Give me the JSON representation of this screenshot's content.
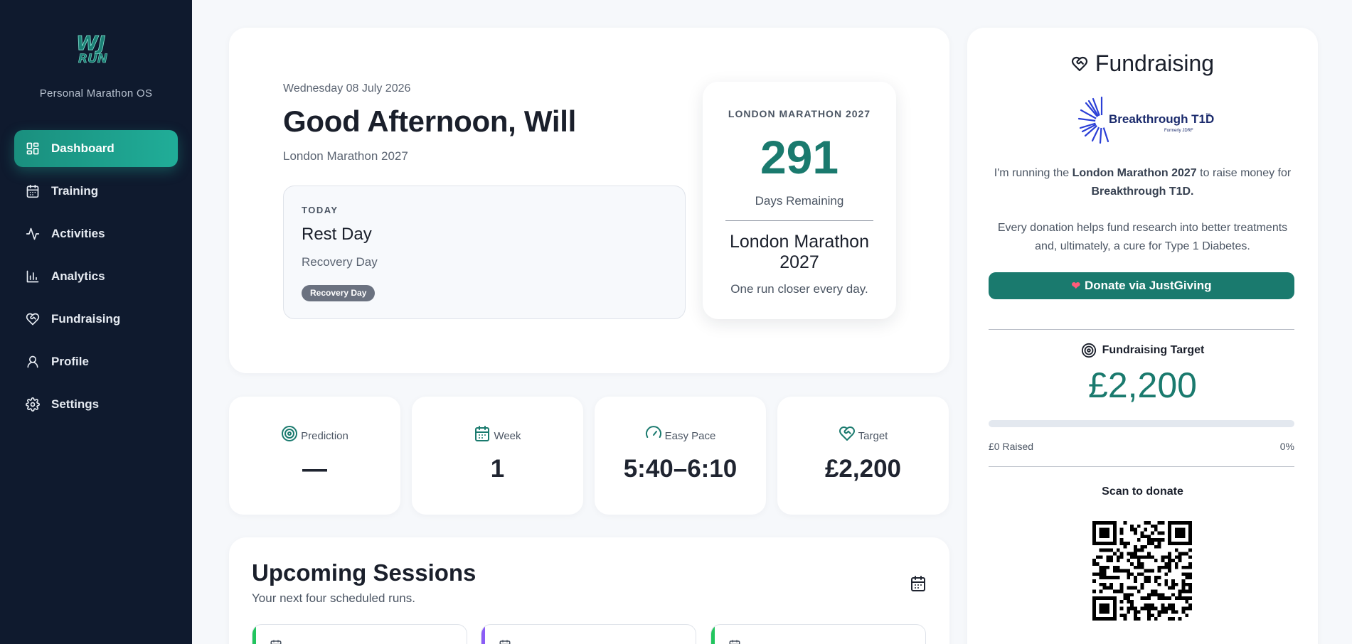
{
  "sidebar": {
    "logo_text_top": "WJ",
    "logo_text_bottom": "RUN",
    "tagline": "Personal Marathon OS",
    "items": [
      {
        "label": "Dashboard"
      },
      {
        "label": "Training"
      },
      {
        "label": "Activities"
      },
      {
        "label": "Analytics"
      },
      {
        "label": "Fundraising"
      },
      {
        "label": "Profile"
      },
      {
        "label": "Settings"
      }
    ]
  },
  "hero": {
    "date": "Wednesday 08 July 2026",
    "greeting": "Good Afternoon, Will",
    "event": "London Marathon 2027",
    "today": {
      "label": "TODAY",
      "title": "Rest Day",
      "subtitle": "Recovery Day",
      "badge": "Recovery Day"
    },
    "countdown": {
      "label": "LONDON MARATHON 2027",
      "days": "291",
      "days_label": "Days Remaining",
      "event": "London Marathon 2027",
      "tagline": "One run closer every day."
    }
  },
  "stats": [
    {
      "label": "Prediction",
      "value": "—",
      "icon": "target-icon"
    },
    {
      "label": "Week",
      "value": "1",
      "icon": "calendar-icon"
    },
    {
      "label": "Easy Pace",
      "value": "5:40–6:10",
      "icon": "gauge-icon"
    },
    {
      "label": "Target",
      "value": "£2,200",
      "icon": "heart-handshake-icon"
    }
  ],
  "upcoming": {
    "title": "Upcoming Sessions",
    "subtitle": "Your next four scheduled runs."
  },
  "fundraising": {
    "title": "Fundraising",
    "charity_name": "Breakthrough T1D",
    "charity_tm": "™",
    "charity_sub": "Formerly JDRF",
    "intro_1": "I'm running the ",
    "intro_event": "London Marathon 2027",
    "intro_2": " to raise money for ",
    "intro_charity": "Breakthrough T1D.",
    "body": "Every donation helps fund research into better treatments and, ultimately, a cure for Type 1 Diabetes.",
    "donate_label": "Donate via JustGiving",
    "target_label": "Fundraising Target",
    "target_value": "£2,200",
    "progress_percent": 0,
    "raised": "£0 Raised",
    "percent_label": "0%",
    "scan_label": "Scan to donate"
  },
  "colors": {
    "accent": "#1a7a6e",
    "sidebar_bg": "#0f1a2e",
    "active_nav": "#20ad98",
    "session_bar_1": "#22c55e",
    "session_bar_2": "#8b5cf6",
    "session_bar_3": "#22c55e"
  }
}
